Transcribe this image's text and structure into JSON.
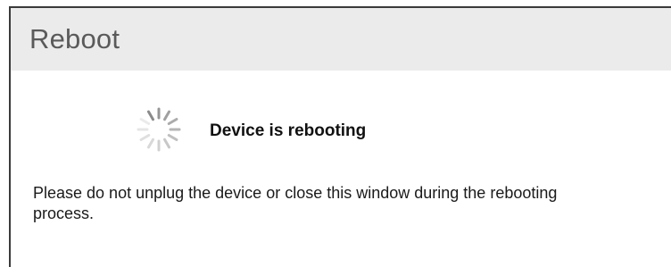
{
  "dialog": {
    "title": "Reboot",
    "status": {
      "icon": "loading-spinner-icon",
      "text": "Device is rebooting"
    },
    "message": "Please do not unplug the device or close this window during the rebooting process."
  },
  "colors": {
    "header_background": "#ebebeb",
    "title_color": "#5a5a5a",
    "spinner_color": "#8a8a8a"
  }
}
